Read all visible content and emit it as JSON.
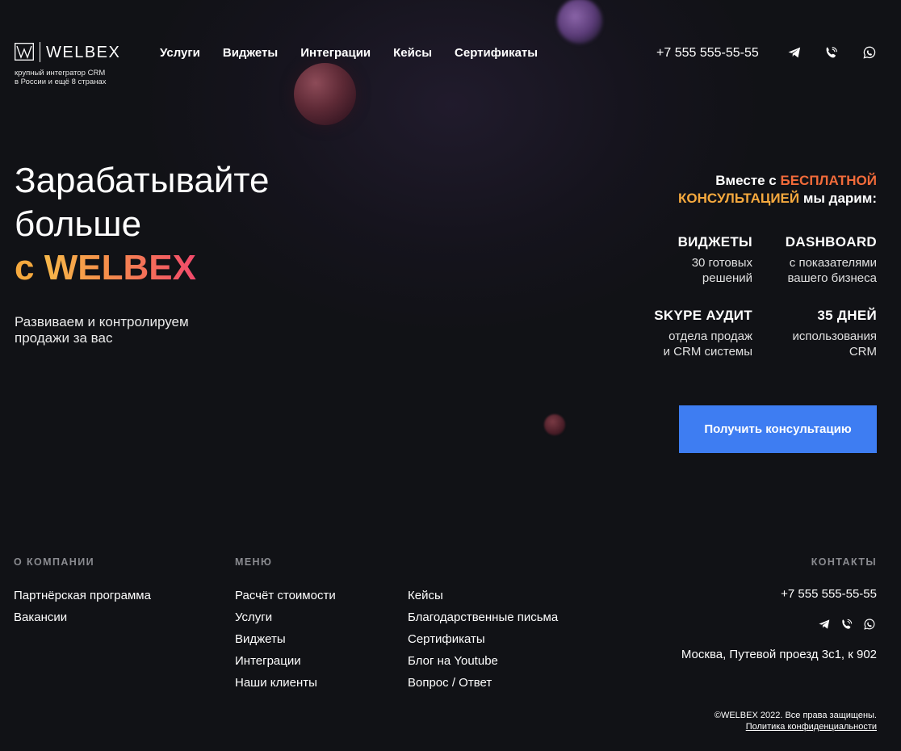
{
  "colors": {
    "background": "#111216",
    "accent_blue": "#3e7df2",
    "accent_orange": "#f5a93e",
    "accent_red_orange": "#f26b3a",
    "accent_pink": "#f2496b",
    "muted_heading": "#8a8b90"
  },
  "header": {
    "logo_text": "WELBEX",
    "logo_icon": "welbex-logo-icon",
    "tagline_line1": "крупный интегратор CRM",
    "tagline_line2": "в России и ещё 8 странах",
    "nav": [
      "Услуги",
      "Виджеты",
      "Интеграции",
      "Кейсы",
      "Сертификаты"
    ],
    "phone": "+7 555 555-55-55",
    "icons": [
      "telegram-icon",
      "viber-icon",
      "whatsapp-icon"
    ]
  },
  "hero": {
    "title_line1": "Зарабатывайте",
    "title_line2": "больше",
    "title_prefix": "с",
    "title_brand": "WELBEX",
    "subtitle_line1": "Развиваем и контролируем",
    "subtitle_line2": "продажи за вас"
  },
  "offer": {
    "head_part1": "Вместе с",
    "head_highlight1": "БЕСПЛАТНОЙ",
    "head_highlight2": "КОНСУЛЬТАЦИЕЙ",
    "head_part2": "мы дарим:",
    "features": [
      {
        "title": "ВИДЖЕТЫ",
        "desc1": "30 готовых",
        "desc2": "решений"
      },
      {
        "title": "DASHBOARD",
        "desc1": "с показателями",
        "desc2": "вашего бизнеса"
      },
      {
        "title": "SKYPE АУДИТ",
        "desc1": "отдела продаж",
        "desc2": "и CRM системы"
      },
      {
        "title": "35 ДНЕЙ",
        "desc1": "использования",
        "desc2": "CRM"
      }
    ],
    "cta_label": "Получить консультацию"
  },
  "footer": {
    "about_heading": "О КОМПАНИИ",
    "about_links": [
      "Партнёрская программа",
      "Вакансии"
    ],
    "menu_heading": "МЕНЮ",
    "menu_col1": [
      "Расчёт стоимости",
      "Услуги",
      "Виджеты",
      "Интеграции",
      "Наши клиенты"
    ],
    "menu_col2": [
      "Кейсы",
      "Благодарственные письма",
      "Сертификаты",
      "Блог на Youtube",
      "Вопрос / Ответ"
    ],
    "contacts_heading": "КОНТАКТЫ",
    "phone": "+7 555 555-55-55",
    "address": "Москва, Путевой проезд 3с1, к 902",
    "copyright": "©WELBEX 2022. Все права защищены.",
    "privacy": "Политика конфиденциальности"
  }
}
